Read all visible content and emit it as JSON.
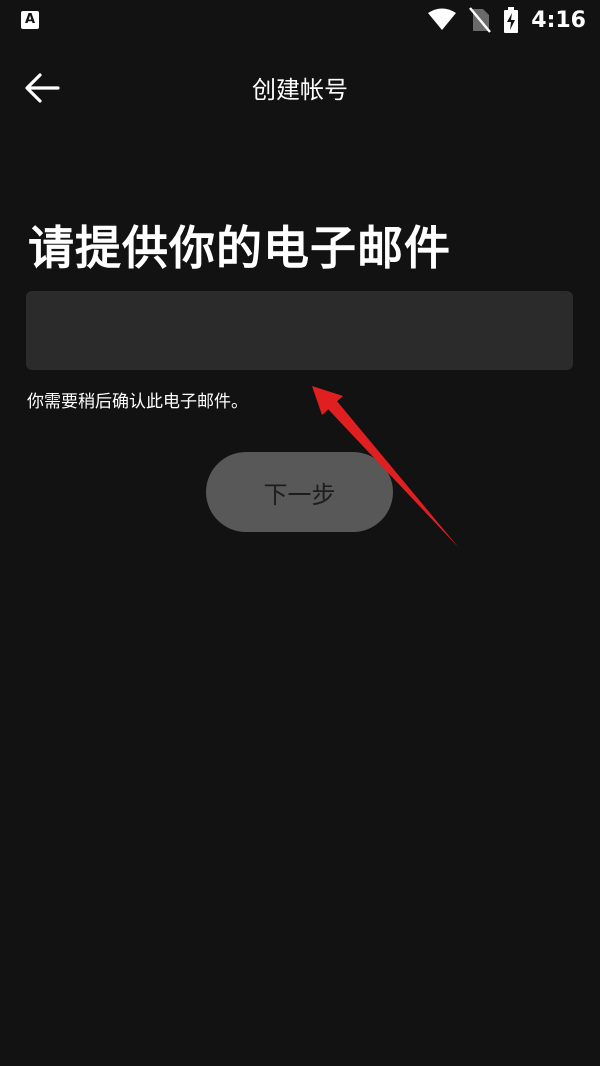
{
  "status_bar": {
    "left_icon_letter": "A",
    "icons": [
      "wifi-icon",
      "sim-off-icon",
      "battery-charging-icon"
    ],
    "time": "4:16"
  },
  "app_bar": {
    "back_icon": "arrow-left-icon",
    "title": "创建帐号"
  },
  "main": {
    "heading": "请提供你的电子邮件",
    "email_input": {
      "value": "",
      "placeholder": ""
    },
    "helper_text": "你需要稍后确认此电子邮件。",
    "next_button_label": "下一步"
  },
  "colors": {
    "background": "#121212",
    "input_bg": "#2b2b2b",
    "button_bg": "#585858",
    "annotation_arrow": "#e02020"
  }
}
